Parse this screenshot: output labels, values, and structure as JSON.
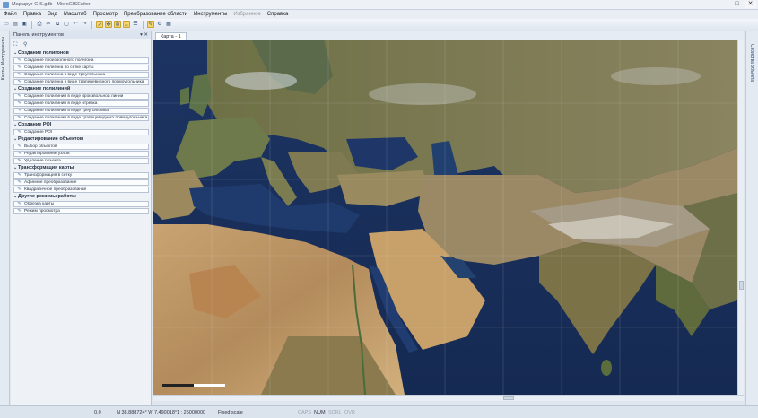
{
  "window": {
    "title": "Маршрут-GIS.gdb - MicroGISEditor",
    "controls": [
      "–",
      "□",
      "✕"
    ]
  },
  "menu": {
    "items": [
      "Файл",
      "Правка",
      "Вид",
      "Масштаб",
      "Просмотр",
      "Преобразование области",
      "Инструменты",
      "Избранное",
      "Справка"
    ],
    "disabled_index": 7
  },
  "toolbar": {
    "icons": [
      "new-icon",
      "open-icon",
      "save-icon",
      "print-icon",
      "cut-icon",
      "copy-icon",
      "paste-icon",
      "undo-icon",
      "redo-icon",
      "select-icon",
      "pan-icon",
      "zoom-icon",
      "measure-icon",
      "layers-icon",
      "highlight-icon",
      "settings-icon",
      "grid-icon"
    ]
  },
  "panel": {
    "title": "Панель инструментов",
    "header_buttons": "▾ ✕",
    "tool_icons": [
      "tree-icon",
      "filter-icon"
    ]
  },
  "groups": [
    {
      "title": "Создание полигонов",
      "items": [
        "Создание произвольного полигона",
        "Создание полигона по сетке карты",
        "Создание полигона в виде треугольника",
        "Создание полигона в виде трапецевидного прямоугольника"
      ]
    },
    {
      "title": "Создание полилиний",
      "items": [
        "Создание полилинии в виде произвольной линии",
        "Создание полилинии в виде отрезка",
        "Создание полилинии в виде треугольника",
        "Создание полилинии в виде трапецевидного прямоугольника"
      ]
    },
    {
      "title": "Создание POI",
      "items": [
        "Создание POI"
      ]
    },
    {
      "title": "Редактирование объектов",
      "items": [
        "Выбор объектов",
        "Редактирование узлов",
        "Удаление объекта"
      ]
    },
    {
      "title": "Трансформация карты",
      "items": [
        "Трансформация в сетку",
        "Афинное преобразование",
        "Квадратичное преобразование"
      ]
    },
    {
      "title": "Другие режимы работы",
      "items": [
        "Обрезка карты",
        "Режим просмотра"
      ]
    }
  ],
  "left_tabs": [
    "Инструменты",
    "Карты"
  ],
  "right_tab": "Свойства объекта",
  "map": {
    "tab_label": "Карта - 1",
    "scale_bar_label": "0 500 км"
  },
  "status": {
    "zoom": "0.0",
    "coords": "N 38.888724° W 7.490018°",
    "scale": "1 : 25000000",
    "mode": "Fixed scale",
    "indicators": [
      "CAPS",
      "NUM",
      "SCRL",
      "OVR"
    ]
  }
}
